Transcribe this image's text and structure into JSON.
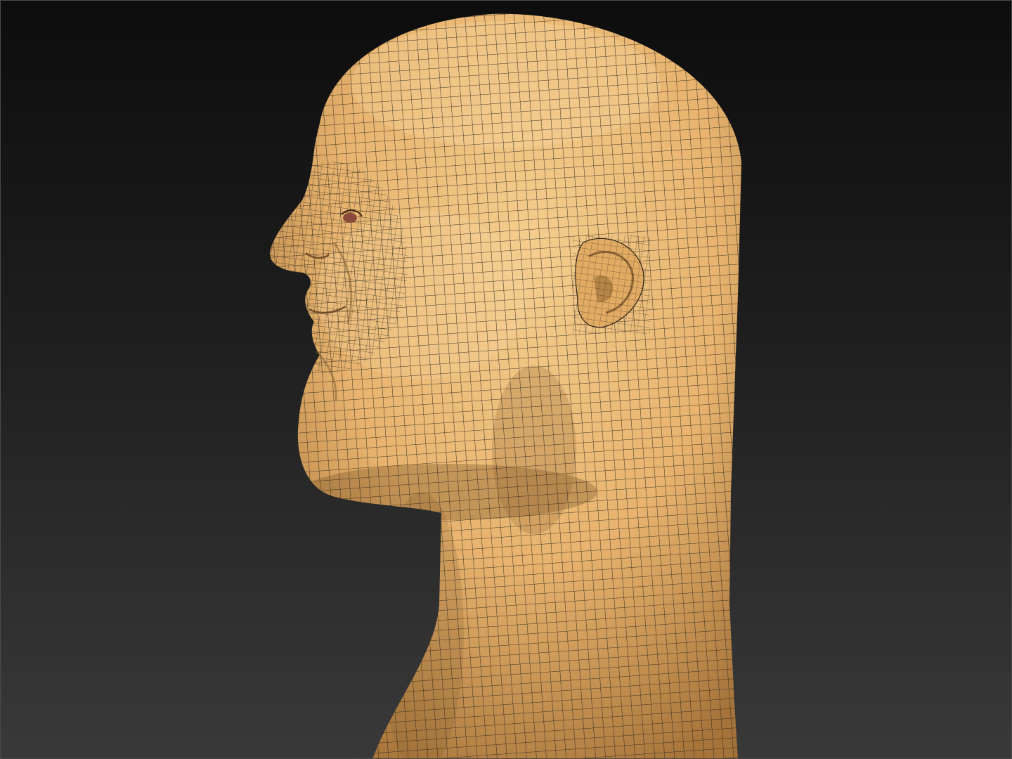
{
  "viewport": {
    "background_top": "#0d0d0d",
    "background_bottom": "#393939"
  },
  "model": {
    "subject": "head-bust",
    "view": "left-profile",
    "material_color": "#e8b46f",
    "highlight_color": "#f4cd8e",
    "shadow_color": "#a7753b",
    "wireframe_color": "#2b2216",
    "wireframe_visible": true,
    "eye_color": "#8a4a3a"
  }
}
